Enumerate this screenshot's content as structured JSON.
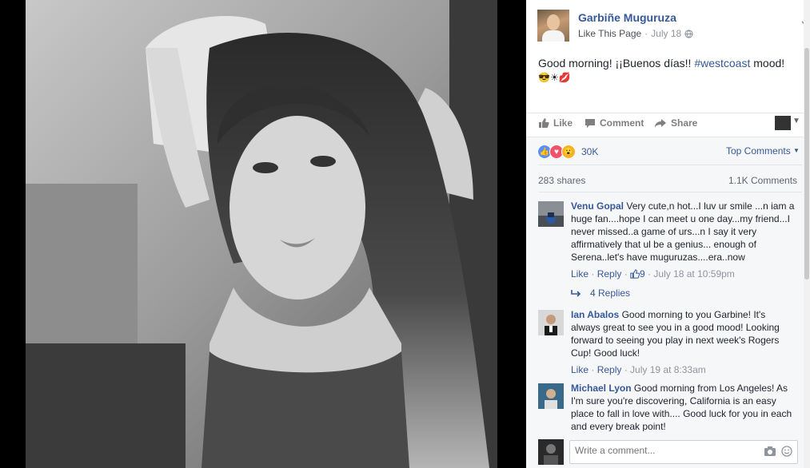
{
  "post": {
    "page_name": "Garbiñe Muguruza",
    "like_page": "Like This Page",
    "date": "July 18",
    "text_before": "Good morning! ¡¡Buenos días!! ",
    "hashtag": "#westcoast",
    "text_after": " mood!",
    "emoji_line": "😎☀💋"
  },
  "actions": {
    "like": "Like",
    "comment": "Comment",
    "share": "Share"
  },
  "reactions": {
    "count": "30K",
    "sort": "Top Comments"
  },
  "stats": {
    "shares": "283 shares",
    "comments": "1.1K Comments"
  },
  "comments": [
    {
      "name": "Venu Gopal",
      "text": "Very cute,n hot...I luv ur smile ...n iam a huge fan....hope I can meet u one day...my friend...I never missed..a game of urs...n I say it very affirmatively that ul be a genius... enough of Serena..let's have muguruzas....era..now",
      "like": "Like",
      "reply": "Reply",
      "likes": "9",
      "time": "July 18 at 10:59pm",
      "replies": "4 Replies"
    },
    {
      "name": "Ian Abalos",
      "text": "Good morning to you Garbine! It's always great to see you in a good mood! Looking forward to seeing you play in next week's Rogers Cup! Good luck!",
      "like": "Like",
      "reply": "Reply",
      "time": "July 19 at 8:33am"
    },
    {
      "name": "Michael Lyon",
      "text": "Good morning from Los Angeles! As I'm sure you're discovering, California is an easy place to fall in love with.... Good luck for you in each and every break point!"
    }
  ],
  "composer": {
    "placeholder": "Write a comment..."
  },
  "colors": {
    "link": "#365899",
    "muted": "#90949c",
    "like_react": "#5890ff",
    "love_react": "#f25268",
    "wow_react": "#f7b125"
  }
}
